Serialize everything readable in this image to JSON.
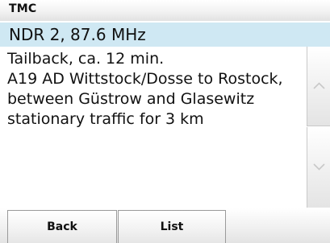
{
  "header": {
    "title": "TMC"
  },
  "station": {
    "label": "NDR 2, 87.6 MHz"
  },
  "message": {
    "text": "Tailback, ca. 12 min.\nA19 AD Wittstock/Dosse to Rostock, between Güstrow and Glasewitz stationary traffic for 3 km"
  },
  "scrollbar": {
    "up_icon": "chevron-up-icon",
    "down_icon": "chevron-down-icon"
  },
  "buttons": {
    "back_label": "Back",
    "list_label": "List"
  }
}
